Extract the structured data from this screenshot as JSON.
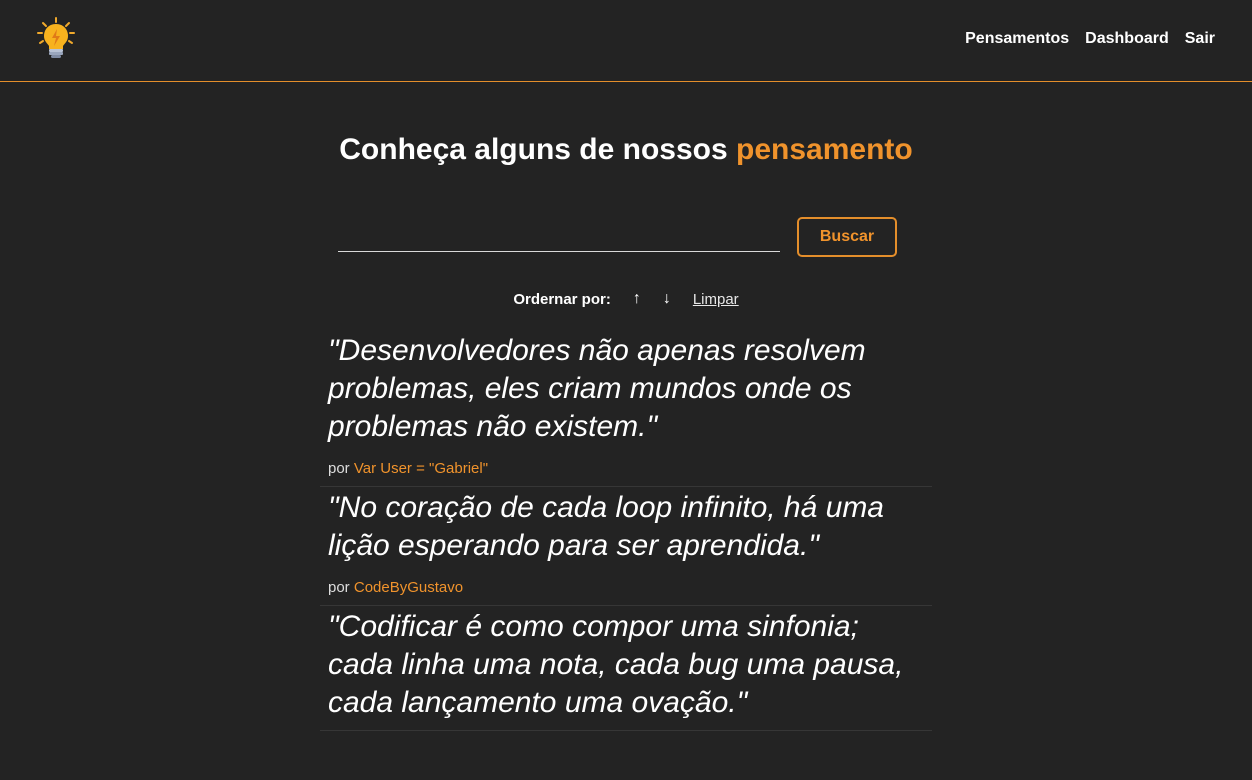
{
  "navbar": {
    "links": [
      "Pensamentos",
      "Dashboard",
      "Sair"
    ]
  },
  "page": {
    "title_prefix": "Conheça alguns de nossos ",
    "title_accent": "pensamento"
  },
  "search": {
    "value": "",
    "button_label": "Buscar"
  },
  "order": {
    "label": "Ordernar por:",
    "asc": "↑",
    "desc": "↓",
    "clear": "Limpar"
  },
  "quotes": [
    {
      "text": "\"Desenvolvedores não apenas resolvem problemas, eles criam mundos onde os problemas não existem.\"",
      "by": "por ",
      "author": "Var User = \"Gabriel\""
    },
    {
      "text": "\"No coração de cada loop infinito, há uma lição esperando para ser aprendida.\"",
      "by": "por ",
      "author": "CodeByGustavo"
    },
    {
      "text": "\"Codificar é como compor uma sinfonia; cada linha uma nota, cada bug uma pausa, cada lançamento uma ovação.\"",
      "by": "",
      "author": ""
    }
  ],
  "colors": {
    "background": "#232323",
    "accent": "#f0932c"
  },
  "icons": {
    "logo": "lightbulb-icon"
  }
}
